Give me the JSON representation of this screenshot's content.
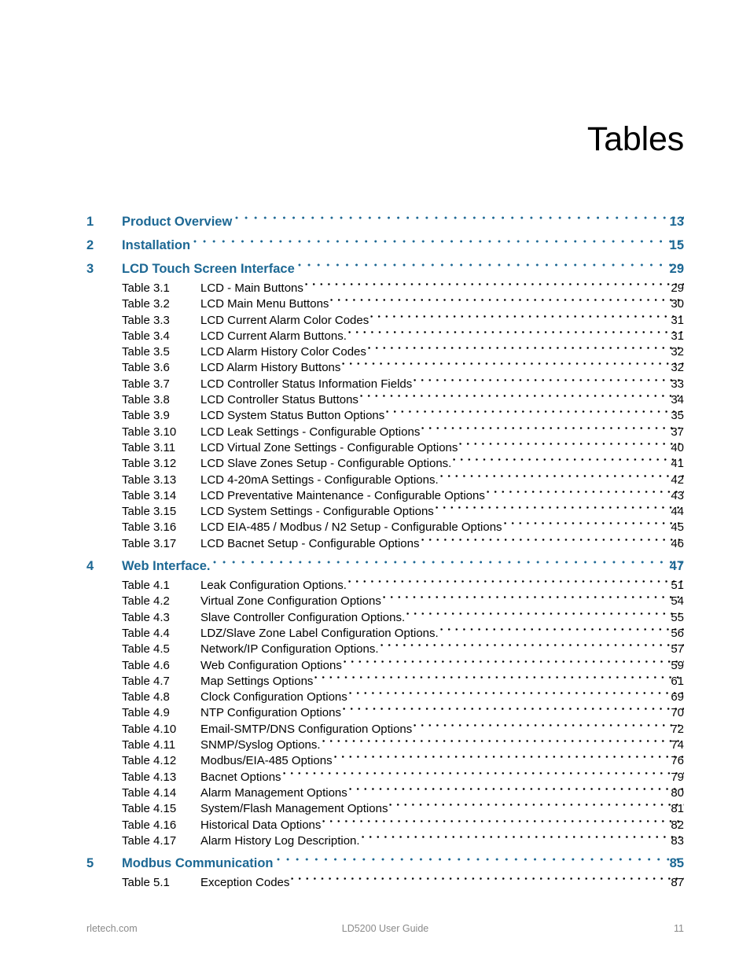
{
  "page_title": "Tables",
  "colors": {
    "accent_blue": "#1d6894",
    "body_text": "#000000",
    "footer_text": "#8a8a8a"
  },
  "toc": {
    "chapters": [
      {
        "number": "1",
        "title": "Product Overview",
        "page": "13",
        "tables": []
      },
      {
        "number": "2",
        "title": "Installation",
        "page": "15",
        "tables": []
      },
      {
        "number": "3",
        "title": "LCD Touch Screen Interface",
        "page": "29",
        "tables": [
          {
            "label": "Table 3.1",
            "title": "LCD - Main Buttons",
            "page": "29"
          },
          {
            "label": "Table 3.2",
            "title": "LCD Main Menu Buttons",
            "page": "30"
          },
          {
            "label": "Table 3.3",
            "title": "LCD Current Alarm Color Codes",
            "page": "31"
          },
          {
            "label": "Table 3.4",
            "title": "LCD Current Alarm Buttons.",
            "page": "31"
          },
          {
            "label": "Table 3.5",
            "title": "LCD Alarm History Color Codes",
            "page": "32"
          },
          {
            "label": "Table 3.6",
            "title": "LCD Alarm History Buttons",
            "page": "32"
          },
          {
            "label": "Table 3.7",
            "title": "LCD Controller Status Information Fields",
            "page": "33"
          },
          {
            "label": "Table 3.8",
            "title": "LCD Controller Status Buttons",
            "page": "34"
          },
          {
            "label": "Table 3.9",
            "title": "LCD System Status Button Options",
            "page": "35"
          },
          {
            "label": "Table 3.10",
            "title": "LCD Leak Settings - Configurable Options",
            "page": "37"
          },
          {
            "label": "Table 3.11",
            "title": "LCD Virtual Zone Settings - Configurable Options",
            "page": "40"
          },
          {
            "label": "Table 3.12",
            "title": "LCD Slave Zones Setup - Configurable Options.",
            "page": "41"
          },
          {
            "label": "Table 3.13",
            "title": "LCD 4-20mA Settings - Configurable Options.",
            "page": "42"
          },
          {
            "label": "Table 3.14",
            "title": "LCD Preventative Maintenance - Configurable Options",
            "page": "43"
          },
          {
            "label": "Table 3.15",
            "title": "LCD System Settings - Configurable Options",
            "page": "44"
          },
          {
            "label": "Table 3.16",
            "title": "LCD EIA-485 / Modbus / N2 Setup - Configurable Options",
            "page": "45"
          },
          {
            "label": "Table 3.17",
            "title": "LCD Bacnet Setup - Configurable Options",
            "page": "46"
          }
        ]
      },
      {
        "number": "4",
        "title": "Web Interface.",
        "page": "47",
        "tables": [
          {
            "label": "Table 4.1",
            "title": "Leak Configuration Options.",
            "page": "51"
          },
          {
            "label": "Table 4.2",
            "title": "Virtual Zone Configuration Options",
            "page": "54"
          },
          {
            "label": "Table 4.3",
            "title": "Slave Controller Configuration Options.",
            "page": "55"
          },
          {
            "label": "Table 4.4",
            "title": "LDZ/Slave Zone Label Configuration Options.",
            "page": "56"
          },
          {
            "label": "Table 4.5",
            "title": "Network/IP Configuration Options.",
            "page": "57"
          },
          {
            "label": "Table 4.6",
            "title": "Web Configuration Options",
            "page": "59"
          },
          {
            "label": "Table 4.7",
            "title": "Map Settings Options",
            "page": "61"
          },
          {
            "label": "Table 4.8",
            "title": "Clock Configuration Options",
            "page": "69"
          },
          {
            "label": "Table 4.9",
            "title": "NTP Configuration Options",
            "page": "70"
          },
          {
            "label": "Table 4.10",
            "title": "Email-SMTP/DNS Configuration Options",
            "page": "72"
          },
          {
            "label": "Table 4.11",
            "title": "SNMP/Syslog Options.",
            "page": "74"
          },
          {
            "label": "Table 4.12",
            "title": "Modbus/EIA-485 Options",
            "page": "76"
          },
          {
            "label": "Table 4.13",
            "title": "Bacnet Options",
            "page": "79"
          },
          {
            "label": "Table 4.14",
            "title": "Alarm Management Options",
            "page": "80"
          },
          {
            "label": "Table 4.15",
            "title": "System/Flash Management Options",
            "page": "81"
          },
          {
            "label": "Table 4.16",
            "title": "Historical Data Options",
            "page": "82"
          },
          {
            "label": "Table 4.17",
            "title": "Alarm History Log Description.",
            "page": "83"
          }
        ]
      },
      {
        "number": "5",
        "title": "Modbus Communication",
        "page": "85",
        "tables": [
          {
            "label": "Table 5.1",
            "title": "Exception Codes",
            "page": "87"
          }
        ]
      }
    ]
  },
  "footer": {
    "left": "rletech.com",
    "center": "LD5200 User Guide",
    "right": "11"
  }
}
